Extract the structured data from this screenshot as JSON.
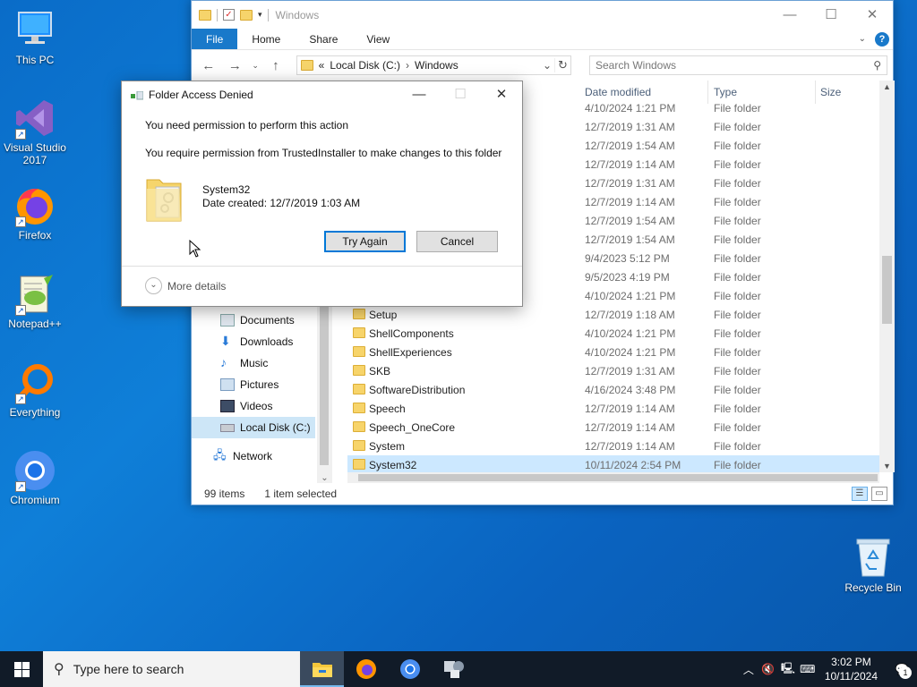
{
  "desktop": {
    "icons": [
      {
        "label": "This PC",
        "icon": "this-pc-icon"
      },
      {
        "label": "Visual Studio 2017",
        "icon": "visual-studio-icon"
      },
      {
        "label": "Firefox",
        "icon": "firefox-icon"
      },
      {
        "label": "Notepad++",
        "icon": "notepadpp-icon"
      },
      {
        "label": "Everything",
        "icon": "everything-icon"
      },
      {
        "label": "Chromium",
        "icon": "chromium-icon"
      }
    ],
    "recycle_bin": "Recycle Bin"
  },
  "explorer": {
    "title": "Windows",
    "ribbon_tabs": [
      "File",
      "Home",
      "Share",
      "View"
    ],
    "address": {
      "root": "«",
      "crumbs": [
        "Local Disk (C:)",
        "Windows"
      ]
    },
    "search_placeholder": "Search Windows",
    "nav_items": [
      "Documents",
      "Downloads",
      "Music",
      "Pictures",
      "Videos",
      "Local Disk (C:)",
      "Network"
    ],
    "columns": {
      "date": "Date modified",
      "type": "Type",
      "size": "Size"
    },
    "rows": [
      {
        "name": "",
        "date": "4/10/2024 1:21 PM",
        "type": "File folder"
      },
      {
        "name": "",
        "date": "12/7/2019 1:31 AM",
        "type": "File folder"
      },
      {
        "name": "",
        "date": "12/7/2019 1:54 AM",
        "type": "File folder"
      },
      {
        "name": "",
        "date": "12/7/2019 1:14 AM",
        "type": "File folder"
      },
      {
        "name": "",
        "date": "12/7/2019 1:31 AM",
        "type": "File folder"
      },
      {
        "name": "",
        "date": "12/7/2019 1:14 AM",
        "type": "File folder"
      },
      {
        "name": "",
        "date": "12/7/2019 1:54 AM",
        "type": "File folder"
      },
      {
        "name": "",
        "date": "12/7/2019 1:54 AM",
        "type": "File folder"
      },
      {
        "name": "",
        "date": "9/4/2023 5:12 PM",
        "type": "File folder"
      },
      {
        "name": "",
        "date": "9/5/2023 4:19 PM",
        "type": "File folder"
      },
      {
        "name": "",
        "date": "4/10/2024 1:21 PM",
        "type": "File folder"
      },
      {
        "name": "Setup",
        "date": "12/7/2019 1:18 AM",
        "type": "File folder"
      },
      {
        "name": "ShellComponents",
        "date": "4/10/2024 1:21 PM",
        "type": "File folder"
      },
      {
        "name": "ShellExperiences",
        "date": "4/10/2024 1:21 PM",
        "type": "File folder"
      },
      {
        "name": "SKB",
        "date": "12/7/2019 1:31 AM",
        "type": "File folder"
      },
      {
        "name": "SoftwareDistribution",
        "date": "4/16/2024 3:48 PM",
        "type": "File folder"
      },
      {
        "name": "Speech",
        "date": "12/7/2019 1:14 AM",
        "type": "File folder"
      },
      {
        "name": "Speech_OneCore",
        "date": "12/7/2019 1:14 AM",
        "type": "File folder"
      },
      {
        "name": "System",
        "date": "12/7/2019 1:14 AM",
        "type": "File folder"
      },
      {
        "name": "System32",
        "date": "10/11/2024 2:54 PM",
        "type": "File folder"
      }
    ],
    "status": {
      "items": "99 items",
      "selected": "1 item selected"
    }
  },
  "dialog": {
    "title": "Folder Access Denied",
    "message1": "You need permission to perform this action",
    "message2": "You require permission from TrustedInstaller to make changes to this folder",
    "folder_name": "System32",
    "folder_date": "Date created: 12/7/2019 1:03 AM",
    "try_again": "Try Again",
    "cancel": "Cancel",
    "more_details": "More details"
  },
  "taskbar": {
    "search_placeholder": "Type here to search",
    "time": "3:02 PM",
    "date": "10/11/2024",
    "notifications": "1"
  }
}
